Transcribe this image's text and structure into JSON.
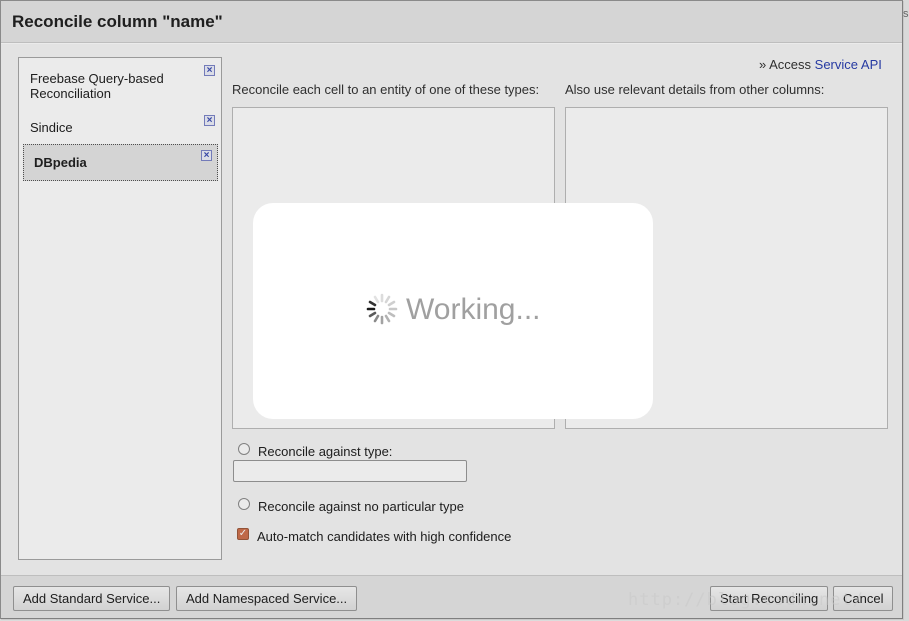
{
  "dialog": {
    "title": "Reconcile column \"name\""
  },
  "services": [
    {
      "label": "Freebase Query-based Reconciliation",
      "remove_glyph": "×"
    },
    {
      "label": "Sindice",
      "remove_glyph": "×"
    },
    {
      "label": "DBpedia",
      "remove_glyph": "×",
      "selected": true
    }
  ],
  "access": {
    "prefix": "» Access",
    "link": "Service API"
  },
  "columns": {
    "types_caption": "Reconcile each cell to an entity of one of these types:",
    "details_caption": "Also use relevant details from other columns:"
  },
  "options": {
    "against_type": "Reconcile against type:",
    "against_type_value": "",
    "no_type": "Reconcile against no particular type",
    "auto_match": "Auto-match candidates with high confidence",
    "auto_match_checked": true
  },
  "footer": {
    "add_standard": "Add Standard Service...",
    "add_namespaced": "Add Namespaced Service...",
    "start": "Start Reconciling",
    "cancel": "Cancel"
  },
  "overlay": {
    "text": "Working..."
  },
  "watermark": "http://blog.csdn.net/",
  "edge_char": "s",
  "colors": {
    "link": "#2a3fb0",
    "checkbox": "#d0724f",
    "working_text": "#a0a0a0"
  },
  "icons": {
    "remove": "close-icon",
    "spinner": "spinner-icon",
    "check": "check-icon"
  }
}
